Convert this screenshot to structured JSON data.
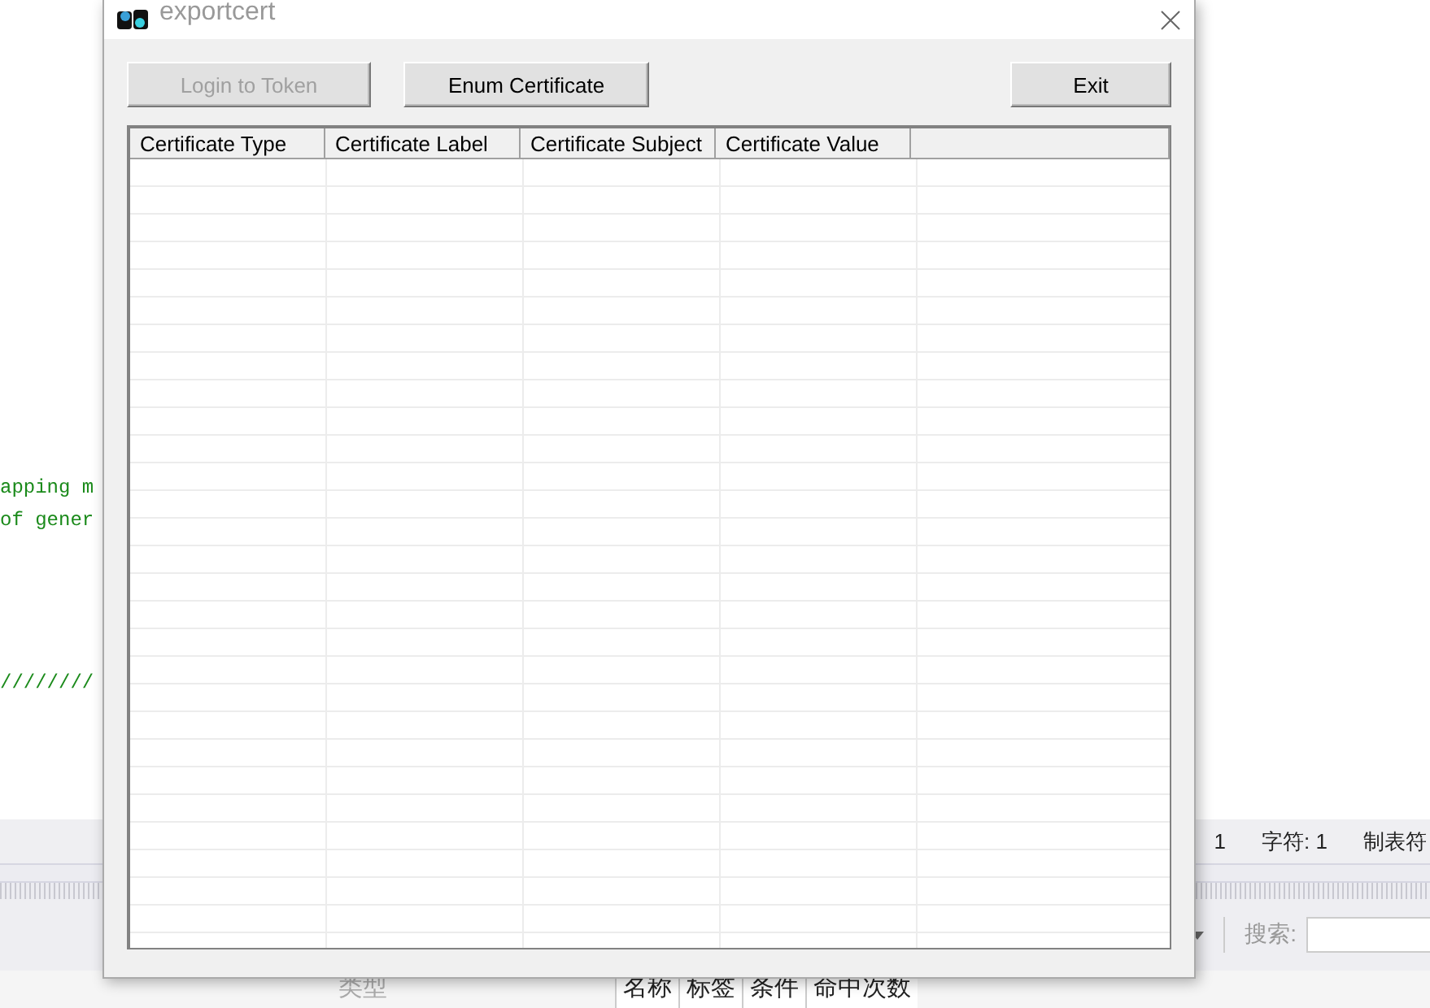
{
  "editor": {
    "code_lines": [
      {
        "text": "apping m"
      },
      {
        "text": "of gener"
      },
      {
        "text": "////////"
      }
    ],
    "status_bar": [
      "1",
      "字符: 1",
      "制表符"
    ],
    "search": {
      "label": "搜索:"
    },
    "bottom_panel": {
      "label": "类型",
      "columns": [
        "名称",
        "标签",
        "条件",
        "命中次数"
      ]
    }
  },
  "dialog": {
    "title": "exportcert",
    "buttons": [
      {
        "label": "Login to Token",
        "disabled": true
      },
      {
        "label": "Enum Certificate",
        "disabled": false
      },
      {
        "label": "Exit",
        "disabled": false
      }
    ],
    "table": {
      "columns": [
        "Certificate Type",
        "Certificate Label",
        "Certificate Subject",
        "Certificate Value"
      ]
    }
  }
}
